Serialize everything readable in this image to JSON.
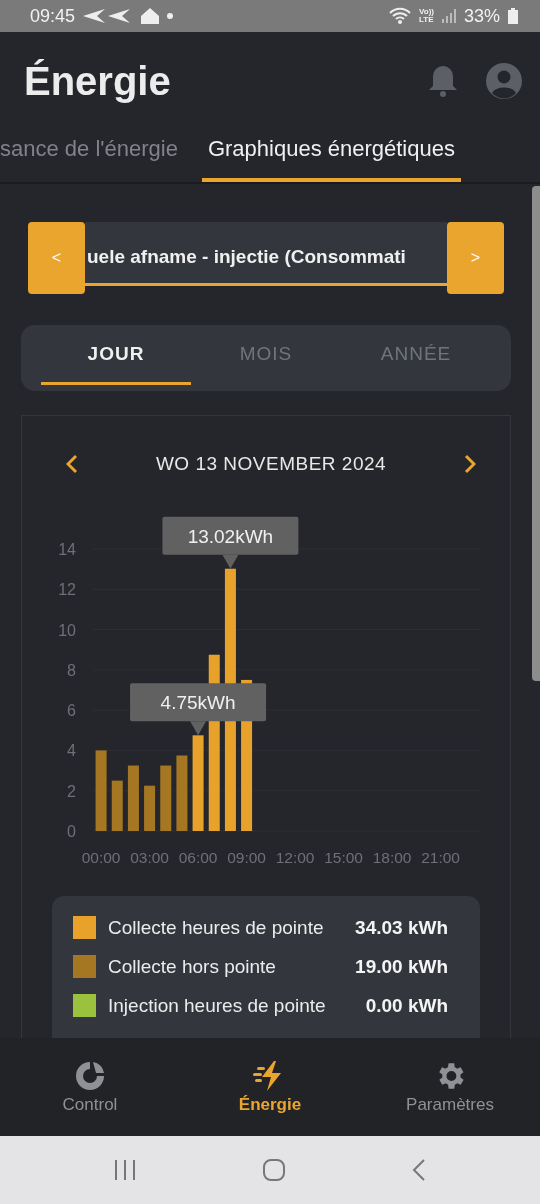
{
  "status_bar": {
    "time": "09:45",
    "volte": [
      "Vo))",
      "LTE"
    ],
    "battery": "33%"
  },
  "header": {
    "title": "Énergie"
  },
  "tabs": [
    {
      "label": "sance de l'énergie",
      "selected": false
    },
    {
      "label": "Graphiques énergétiques",
      "selected": true
    }
  ],
  "selector": {
    "prev": "<",
    "value": "uele afname - injectie (Consommati",
    "next": ">"
  },
  "periods": [
    {
      "label": "JOUR",
      "selected": true
    },
    {
      "label": "MOIS",
      "selected": false
    },
    {
      "label": "ANNÉE",
      "selected": false
    }
  ],
  "date_nav": {
    "date": "WO 13 NOVEMBER 2024"
  },
  "chart_data": {
    "type": "bar",
    "grid": true,
    "x": [
      0,
      1,
      2,
      3,
      4,
      5,
      6,
      7,
      8,
      9
    ],
    "series": [
      {
        "name": "Collecte heures de pointe",
        "color": "#e8a22c",
        "values": [
          null,
          null,
          null,
          null,
          null,
          null,
          4.75,
          8.75,
          13.02,
          7.5
        ]
      },
      {
        "name": "Collecte hors pointe",
        "color": "#a57722",
        "values": [
          4.0,
          2.5,
          3.25,
          2.25,
          3.25,
          3.75,
          null,
          null,
          null,
          null
        ]
      },
      {
        "name": "Injection heures de pointe",
        "color": "#9bc23c",
        "values": [
          null,
          null,
          null,
          null,
          null,
          null,
          null,
          null,
          null,
          null
        ]
      }
    ],
    "xlim": [
      -0.5,
      23.5
    ],
    "ylim": [
      0,
      14
    ],
    "yticks": [
      0,
      2,
      4,
      6,
      8,
      10,
      12,
      14
    ],
    "xticks": [
      {
        "value": 0,
        "label": "00:00"
      },
      {
        "value": 3,
        "label": "03:00"
      },
      {
        "value": 6,
        "label": "06:00"
      },
      {
        "value": 9,
        "label": "09:00"
      },
      {
        "value": 12,
        "label": "12:00"
      },
      {
        "value": 15,
        "label": "15:00"
      },
      {
        "value": 18,
        "label": "18:00"
      },
      {
        "value": 21,
        "label": "21:00"
      }
    ],
    "annotations": [
      {
        "x": 6,
        "y": 4.75,
        "text": "4.75kWh"
      },
      {
        "x": 8,
        "y": 13.02,
        "text": "13.02kWh"
      }
    ]
  },
  "legend": [
    {
      "value": "34.03 kWh"
    },
    {
      "value": "19.00 kWh"
    },
    {
      "value": "0.00 kWh"
    }
  ],
  "bottom_nav": [
    {
      "kind": "control",
      "label": "Control",
      "selected": false
    },
    {
      "kind": "energy",
      "label": "Énergie",
      "selected": true
    },
    {
      "kind": "settings",
      "label": "Paramètres",
      "selected": false
    }
  ]
}
